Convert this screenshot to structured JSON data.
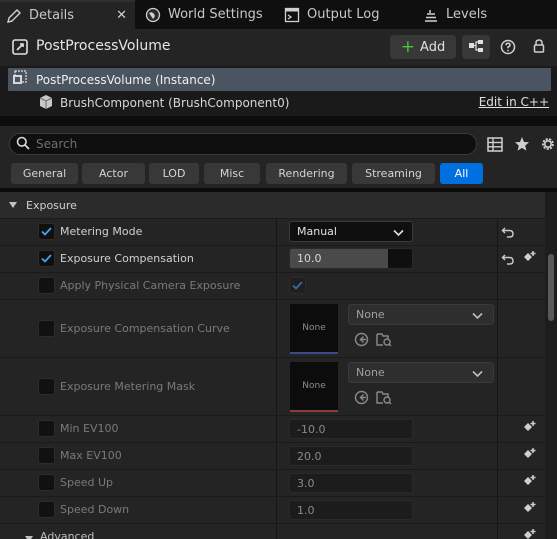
{
  "tabs": [
    {
      "label": "Details",
      "icon": "pencil-icon",
      "active": true
    },
    {
      "label": "World Settings",
      "icon": "globe-icon"
    },
    {
      "label": "Output Log",
      "icon": "terminal-icon"
    },
    {
      "label": "Levels",
      "icon": "stack-icon"
    }
  ],
  "tab_close": "✕",
  "header": {
    "title": "PostProcessVolume",
    "add_label": "Add"
  },
  "tree": {
    "instance_label": "PostProcessVolume (Instance)",
    "brush_label": "BrushComponent (BrushComponent0)",
    "edit_link": "Edit in C++"
  },
  "search": {
    "placeholder": "Search"
  },
  "filters": [
    "General",
    "Actor",
    "LOD",
    "Misc",
    "Rendering",
    "Streaming",
    "All"
  ],
  "filter_selected": "All",
  "category": {
    "label": "Exposure"
  },
  "properties": {
    "metering_mode": {
      "label": "Metering Mode",
      "value": "Manual",
      "checked": true
    },
    "exposure_compensation": {
      "label": "Exposure Compensation",
      "value": "10.0",
      "checked": true,
      "slider_fraction": 0.8
    },
    "apply_physical_camera": {
      "label": "Apply Physical Camera Exposure",
      "checked": false,
      "value_checked": true
    },
    "exposure_compensation_curve": {
      "label": "Exposure Compensation Curve",
      "thumb": "None",
      "asset": "None"
    },
    "exposure_metering_mask": {
      "label": "Exposure Metering Mask",
      "thumb": "None",
      "asset": "None"
    },
    "min_ev100": {
      "label": "Min EV100",
      "value": "-10.0"
    },
    "max_ev100": {
      "label": "Max EV100",
      "value": "20.0"
    },
    "speed_up": {
      "label": "Speed Up",
      "value": "3.0"
    },
    "speed_down": {
      "label": "Speed Down",
      "value": "1.0"
    }
  },
  "advanced": {
    "label": "Advanced"
  },
  "colors": {
    "accent": "#0070e0",
    "selection": "#4b5562",
    "curve_line": "#3c4a8c",
    "mask_line": "#8c3c3c"
  }
}
